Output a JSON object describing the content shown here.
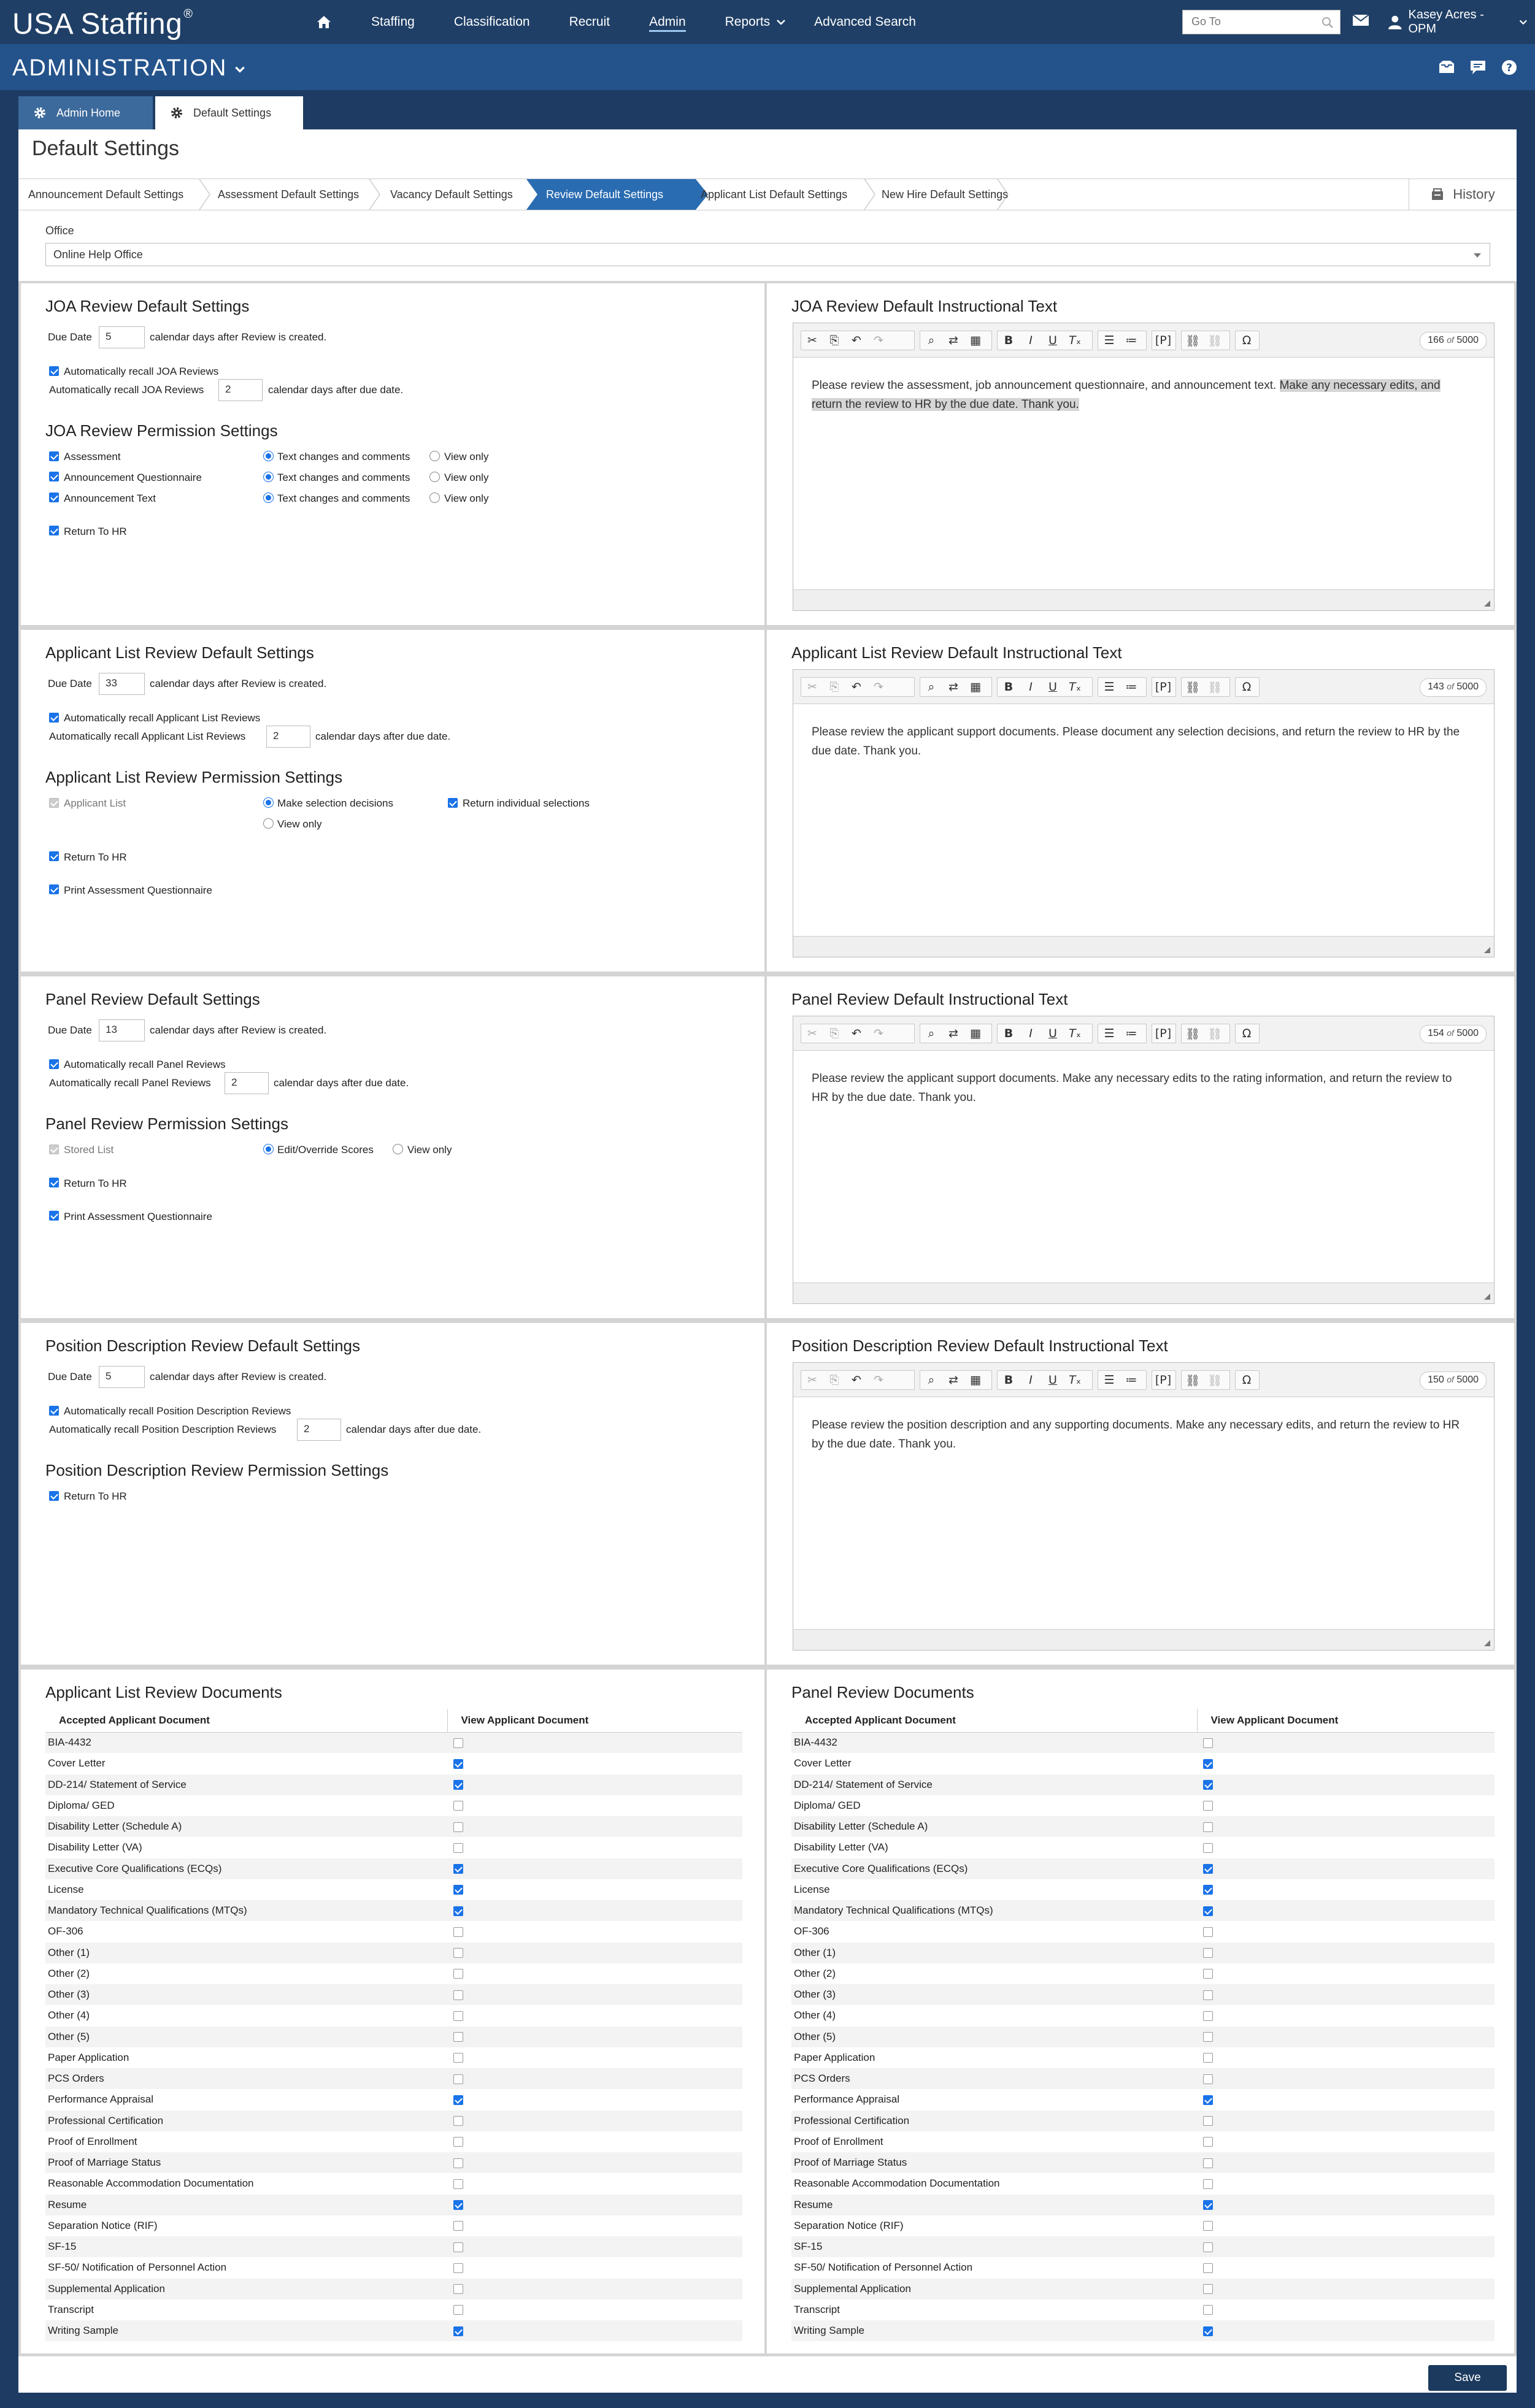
{
  "topbar": {
    "logo": "USA Staffing",
    "logo_mark": "®",
    "nav": [
      "Staffing",
      "Classification",
      "Recruit",
      "Admin",
      "Reports",
      "Advanced Search"
    ],
    "goto_placeholder": "Go To",
    "user": "Kasey Acres - OPM"
  },
  "adminbar": {
    "title": "ADMINISTRATION"
  },
  "page_tabs": [
    "Admin Home",
    "Default Settings"
  ],
  "page_title": "Default Settings",
  "wizard": {
    "steps": [
      "Announcement Default Settings",
      "Assessment Default Settings",
      "Vacancy Default Settings",
      "Review Default Settings",
      "Applicant List Default Settings",
      "New Hire Default Settings"
    ],
    "active_step": "Review Default Settings",
    "history": "History"
  },
  "office": {
    "label": "Office",
    "value": "Online Help Office"
  },
  "common": {
    "due_date": "Due Date",
    "days_after_created": "calendar days after Review is created.",
    "days_after_due": "calendar days after due date.",
    "return_to_hr": "Return To HR",
    "print_aq": "Print Assessment Questionnaire",
    "text_changes": "Text changes and comments",
    "view_only": "View only"
  },
  "joa": {
    "title": "JOA Review Default Settings",
    "due_days": "5",
    "auto_recall_label": "Automatically recall JOA Reviews",
    "auto_recall_days_label": "Automatically recall JOA Reviews",
    "recall_days": "2",
    "perm_title": "JOA Review Permission Settings",
    "perm_items": [
      "Assessment",
      "Announcement Questionnaire",
      "Announcement Text"
    ]
  },
  "joa_text": {
    "title": "JOA Review Default Instructional Text",
    "count": "166",
    "max": "5000",
    "text_a": "Please review the assessment, job announcement questionnaire, and announcement text. ",
    "text_b": "Make any necessary edits, and return the review to HR by the due date. Thank you."
  },
  "al": {
    "title": "Applicant List Review Default Settings",
    "due_days": "33",
    "auto_recall_label": "Automatically recall Applicant List Reviews",
    "auto_recall_days_label": "Automatically recall Applicant List Reviews",
    "recall_days": "2",
    "perm_title": "Applicant List Review Permission Settings",
    "perm_item": "Applicant List",
    "make_selection": "Make selection decisions",
    "view_only": "View only",
    "return_individual": "Return individual selections"
  },
  "al_text": {
    "title": "Applicant List Review Default Instructional Text",
    "count": "143",
    "max": "5000",
    "text": "Please review the applicant support documents. Please document any selection decisions, and return the review to HR by the due date. Thank you."
  },
  "panel": {
    "title": "Panel Review Default Settings",
    "due_days": "13",
    "auto_recall_label": "Automatically recall Panel Reviews",
    "auto_recall_days_label": "Automatically recall Panel Reviews",
    "recall_days": "2",
    "perm_title": "Panel Review Permission Settings",
    "perm_item": "Stored List",
    "edit_override": "Edit/Override Scores",
    "view_only": "View only"
  },
  "panel_text": {
    "title": "Panel Review Default Instructional Text",
    "count": "154",
    "max": "5000",
    "text": "Please review the applicant support documents. Make any necessary edits to the rating information, and return the review to HR by the due date. Thank you."
  },
  "pd": {
    "title": "Position Description Review Default Settings",
    "due_days": "5",
    "auto_recall_label": "Automatically recall Position Description Reviews",
    "auto_recall_days_label": "Automatically recall Position Description Reviews",
    "recall_days": "2",
    "perm_title": "Position Description Review Permission Settings"
  },
  "pd_text": {
    "title": "Position Description Review Default Instructional Text",
    "count": "150",
    "max": "5000",
    "text": "Please review the position description and any supporting documents. Make any necessary edits, and return the review to HR by the due date. Thank you."
  },
  "docs": {
    "al_title": "Applicant List Review Documents",
    "panel_title": "Panel Review Documents",
    "col1": "Accepted Applicant Document",
    "col2": "View Applicant Document",
    "rows": [
      {
        "name": "BIA-4432",
        "al": false,
        "panel": false
      },
      {
        "name": "Cover Letter",
        "al": true,
        "panel": true
      },
      {
        "name": "DD-214/ Statement of Service",
        "al": true,
        "panel": true
      },
      {
        "name": "Diploma/ GED",
        "al": false,
        "panel": false
      },
      {
        "name": "Disability Letter (Schedule A)",
        "al": false,
        "panel": false
      },
      {
        "name": "Disability Letter (VA)",
        "al": false,
        "panel": false
      },
      {
        "name": "Executive Core Qualifications (ECQs)",
        "al": true,
        "panel": true
      },
      {
        "name": "License",
        "al": true,
        "panel": true
      },
      {
        "name": "Mandatory Technical Qualifications (MTQs)",
        "al": true,
        "panel": true
      },
      {
        "name": "OF-306",
        "al": false,
        "panel": false
      },
      {
        "name": "Other (1)",
        "al": false,
        "panel": false
      },
      {
        "name": "Other (2)",
        "al": false,
        "panel": false
      },
      {
        "name": "Other (3)",
        "al": false,
        "panel": false
      },
      {
        "name": "Other (4)",
        "al": false,
        "panel": false
      },
      {
        "name": "Other (5)",
        "al": false,
        "panel": false
      },
      {
        "name": "Paper Application",
        "al": false,
        "panel": false
      },
      {
        "name": "PCS Orders",
        "al": false,
        "panel": false
      },
      {
        "name": "Performance Appraisal",
        "al": true,
        "panel": true
      },
      {
        "name": "Professional Certification",
        "al": false,
        "panel": false
      },
      {
        "name": "Proof of Enrollment",
        "al": false,
        "panel": false
      },
      {
        "name": "Proof of Marriage Status",
        "al": false,
        "panel": false
      },
      {
        "name": "Reasonable Accommodation Documentation",
        "al": false,
        "panel": false
      },
      {
        "name": "Resume",
        "al": true,
        "panel": true
      },
      {
        "name": "Separation Notice (RIF)",
        "al": false,
        "panel": false
      },
      {
        "name": "SF-15",
        "al": false,
        "panel": false
      },
      {
        "name": "SF-50/ Notification of Personnel Action",
        "al": false,
        "panel": false
      },
      {
        "name": "Supplemental Application",
        "al": false,
        "panel": false
      },
      {
        "name": "Transcript",
        "al": false,
        "panel": false
      },
      {
        "name": "Writing Sample",
        "al": true,
        "panel": true
      }
    ]
  },
  "save": "Save",
  "colors": {
    "topbar": "#1f3f66",
    "adminbar": "#24538b",
    "active_step": "#2a6cb2",
    "save": "#1b3a5e",
    "check": "#1a73e8"
  }
}
